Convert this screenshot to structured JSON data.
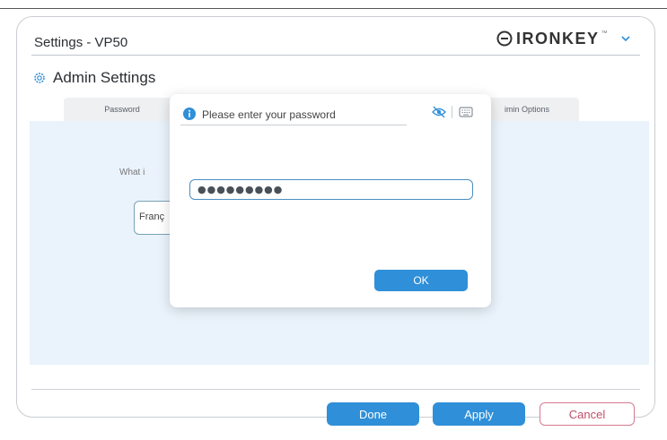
{
  "window": {
    "title": "Settings - VP50"
  },
  "brand": {
    "name": "IRONKEY",
    "trademark": "™",
    "icons": [
      "ironkey-logo-icon",
      "chevron-down-icon"
    ]
  },
  "section": {
    "title": "Admin Settings",
    "icon": "gear-icon"
  },
  "tabs": [
    {
      "label": "Password"
    },
    {
      "label": "Admin Options",
      "visible_text": "imin Options"
    }
  ],
  "panel": {
    "question_partial": "What i",
    "language_partial": "Franç"
  },
  "dialog": {
    "title": "Please enter your password",
    "icons": [
      "info-icon",
      "hide-password-icon",
      "keyboard-icon"
    ],
    "password_masked": "●●●●●●●●●",
    "ok_label": "OK"
  },
  "footer": {
    "done_label": "Done",
    "apply_label": "Apply",
    "cancel_label": "Cancel"
  },
  "colors": {
    "accent": "#2f8fd8",
    "panel_bg": "#eaf3fb",
    "cancel_text": "#c0506a"
  }
}
